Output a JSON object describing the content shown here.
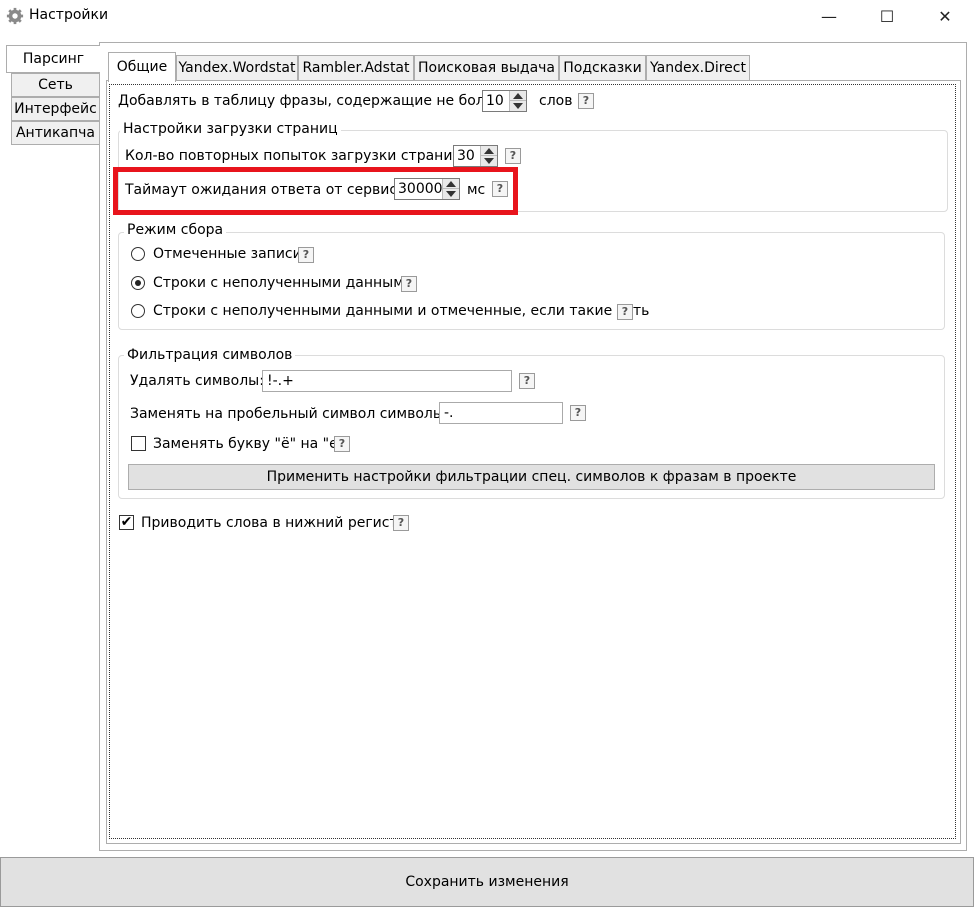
{
  "window": {
    "title": "Настройки",
    "minimize": "—",
    "maximize": "☐",
    "close": "✕"
  },
  "left_tabs": [
    "Парсинг",
    "Сеть",
    "Интерфейс",
    "Антикапча"
  ],
  "top_tabs": [
    "Общие",
    "Yandex.Wordstat",
    "Rambler.Adstat",
    "Поисковая выдача",
    "Подсказки",
    "Yandex.Direct"
  ],
  "general": {
    "phrases_label": "Добавлять в таблицу фразы, содержащие не более",
    "phrases_value": "10",
    "phrases_unit": "слов",
    "help": "?"
  },
  "page_loading": {
    "title": "Настройки загрузки страниц",
    "retries_label": "Кол-во повторных попыток загрузки страниц:",
    "retries_value": "30",
    "timeout_label": "Таймаут ожидания ответа от сервиса:",
    "timeout_value": "30000",
    "timeout_unit": "мс"
  },
  "collection_mode": {
    "title": "Режим сбора",
    "options": [
      "Отмеченные записи",
      "Строки с неполученными данными",
      "Строки с неполученными данными и отмеченные, если такие есть"
    ],
    "selected_index": 1
  },
  "filtering": {
    "title": "Фильтрация символов",
    "delete_label": "Удалять символы:",
    "delete_value": "!-.+",
    "replace_label": "Заменять на пробельный символ символы:",
    "replace_value": "-.",
    "yo_label": "Заменять букву \"ё\" на \"е\"",
    "yo_checked": false,
    "apply_button": "Применить настройки фильтрации спец. символов к фразам в проекте"
  },
  "lowercase": {
    "label": "Приводить слова в нижний регистр",
    "checked": true,
    "mark": "✔"
  },
  "save_button": "Сохранить изменения",
  "colors": {
    "highlight": "#e8141c",
    "button_bg": "#e1e1e1",
    "tab_bg": "#f0f0f0"
  },
  "icons": {
    "app": "gear-icon"
  }
}
